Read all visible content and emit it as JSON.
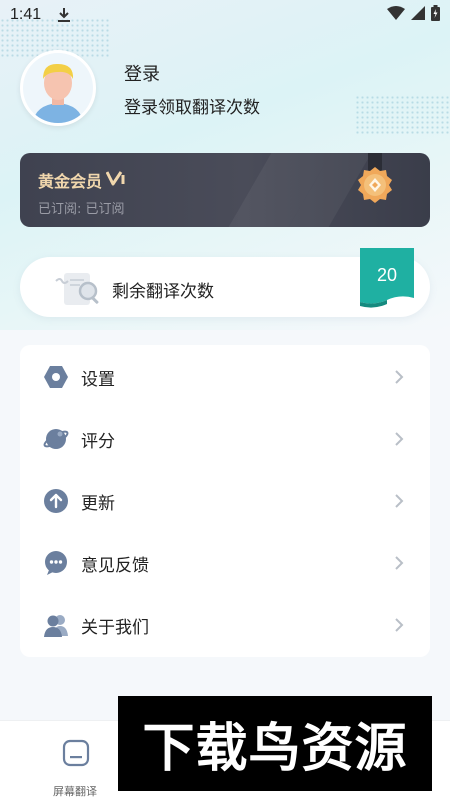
{
  "status_bar": {
    "time": "1:41",
    "icons": [
      "download-icon",
      "wifi-icon",
      "signal-icon",
      "battery-icon"
    ]
  },
  "profile": {
    "title": "登录",
    "subtitle": "登录领取翻译次数"
  },
  "membership": {
    "title": "黄金会员",
    "subtitle": "已订阅: 已订阅",
    "accent": "#f1d7ad"
  },
  "remaining": {
    "label": "剩余翻译次数",
    "count": "20",
    "badge_color": "#1fb0a2"
  },
  "menu": [
    {
      "label": "设置",
      "icon": "settings-hex-icon"
    },
    {
      "label": "评分",
      "icon": "planet-icon"
    },
    {
      "label": "更新",
      "icon": "arrow-up-circle-icon"
    },
    {
      "label": "意见反馈",
      "icon": "chat-bubble-icon"
    },
    {
      "label": "关于我们",
      "icon": "users-icon"
    }
  ],
  "bottom_nav": {
    "tab_label": "屏幕翻译"
  },
  "watermark": {
    "text": "下载鸟资源"
  },
  "colors": {
    "icon_gray_blue": "#6b7f9e",
    "card_dark": "#42444f",
    "teal": "#1fb0a2"
  }
}
